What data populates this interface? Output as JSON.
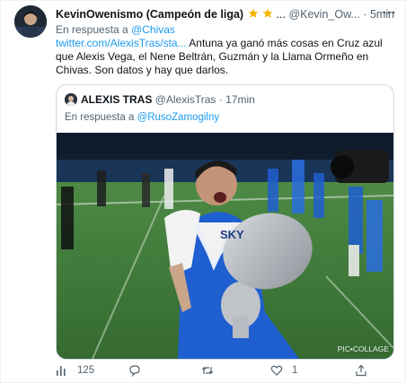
{
  "tweet": {
    "author_name": "KevinOwenismo (Campeón de liga)",
    "star_emojis": "star,star",
    "ellipsis": "...",
    "handle": "@Kevin_Ow...",
    "separator": "·",
    "time": "5min",
    "reply_prefix": "En respuesta a",
    "reply_to": "@Chivas",
    "body_link": "twitter.com/AlexisTras/sta...",
    "body_text": " Antuna ya ganó más cosas en Cruz azul que Alexis Vega, el Nene Beltrán, Guzmán y la Llama Ormeño en Chivas. Son datos y hay que darlos."
  },
  "quoted": {
    "author_name": "ALEXIS TRAS",
    "handle": "@AlexisTras",
    "separator": "·",
    "time": "17min",
    "reply_prefix": "En respuesta a",
    "reply_to": "@RusoZamogilny",
    "photo": {
      "sign_text": "SKY",
      "watermark": "PIC•COLLAGE"
    }
  },
  "actions": {
    "views_count": "125",
    "replies_count": "",
    "retweets_count": "",
    "likes_count": "1"
  },
  "colors": {
    "link": "#1d9bf0",
    "muted": "#536471",
    "star": "#f4b400",
    "jersey": "#1f5fd0",
    "grass": "#3f7a3a"
  },
  "icons": [
    "avatar-photo",
    "star-icon",
    "more-options-icon",
    "views-icon",
    "reply-icon",
    "retweet-icon",
    "like-icon",
    "share-icon"
  ]
}
